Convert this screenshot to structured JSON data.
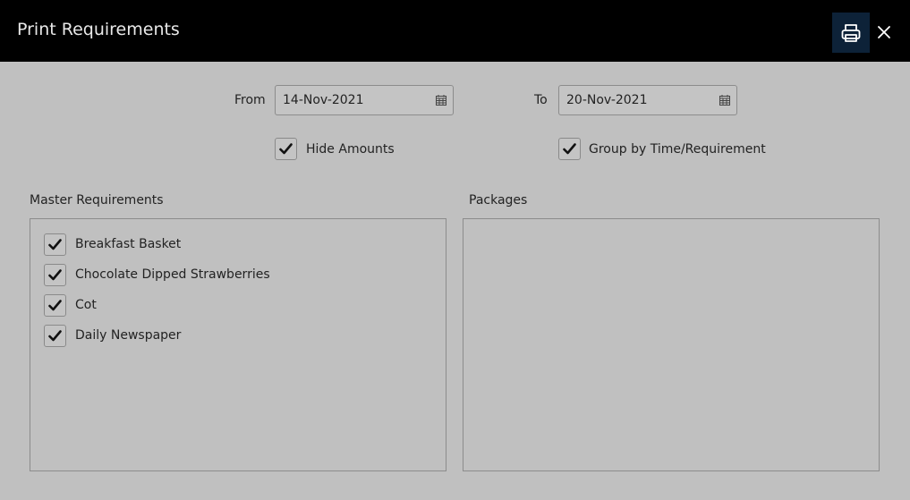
{
  "window": {
    "title": "Print Requirements"
  },
  "header": {
    "print_icon": "printer-icon",
    "close_icon": "close-icon"
  },
  "filters": {
    "from_label": "From",
    "from_value": "14-Nov-2021",
    "to_label": "To",
    "to_value": "20-Nov-2021",
    "calendar_icon": "calendar-icon",
    "hide_amounts": {
      "label": "Hide Amounts",
      "checked": true
    },
    "group_by": {
      "label": "Group by Time/Requirement",
      "checked": true
    }
  },
  "master_requirements": {
    "label": "Master Requirements",
    "items": [
      {
        "label": "Breakfast Basket",
        "checked": true
      },
      {
        "label": "Chocolate Dipped Strawberries",
        "checked": true
      },
      {
        "label": "Cot",
        "checked": true
      },
      {
        "label": "Daily Newspaper",
        "checked": true
      }
    ]
  },
  "packages": {
    "label": "Packages",
    "items": []
  }
}
